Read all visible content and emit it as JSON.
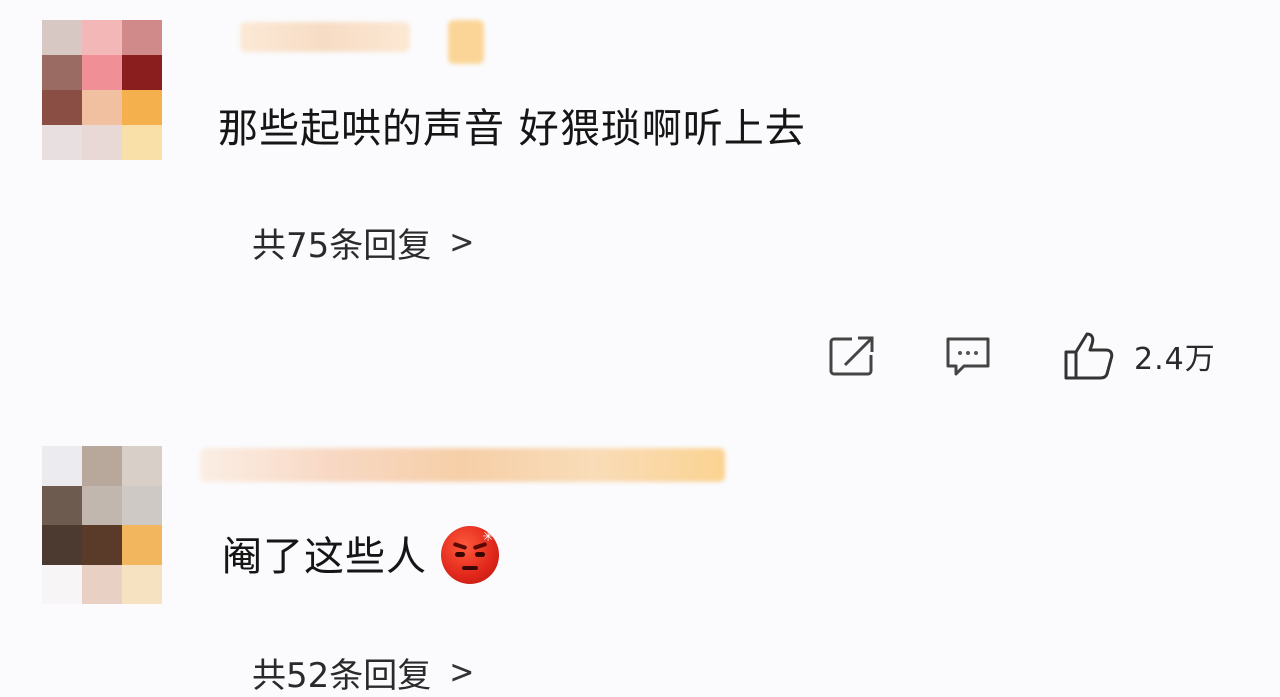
{
  "comments": [
    {
      "text": "那些起哄的声音 好猥琐啊听上去",
      "reply_link": "共75条回复",
      "reply_chevron": ">",
      "like_count": "2.4万"
    },
    {
      "text": "阉了这些人",
      "reply_link": "共52条回复",
      "reply_chevron": ">"
    }
  ],
  "icons": {
    "share": "share-icon",
    "comment": "comment-icon",
    "like": "thumbs-up-icon",
    "emoji": "angry-face-emoji"
  }
}
